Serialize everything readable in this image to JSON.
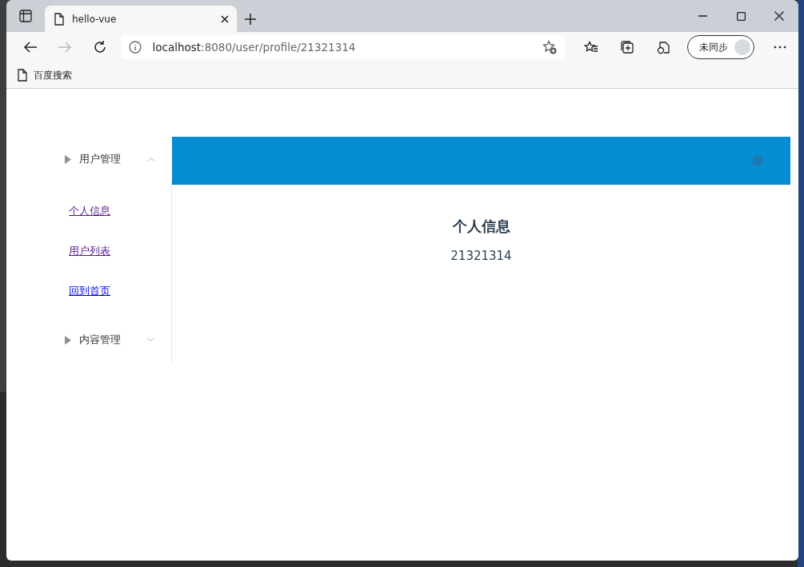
{
  "browser": {
    "tab": {
      "title": "hello-vue",
      "selected": true
    },
    "address": {
      "host": "localhost",
      "path": ":8080/user/profile/21321314"
    },
    "profile": {
      "label": "未同步"
    },
    "bookmarks": [
      "百度搜索"
    ]
  },
  "sidebar": {
    "menus": [
      {
        "label": "用户管理",
        "expanded": true,
        "links": [
          {
            "label": "个人信息",
            "visited": true
          },
          {
            "label": "用户列表",
            "visited": true
          },
          {
            "label": "回到首页",
            "visited": false
          }
        ]
      },
      {
        "label": "内容管理",
        "expanded": false
      }
    ]
  },
  "main": {
    "heading": "个人信息",
    "value": "21321314"
  }
}
